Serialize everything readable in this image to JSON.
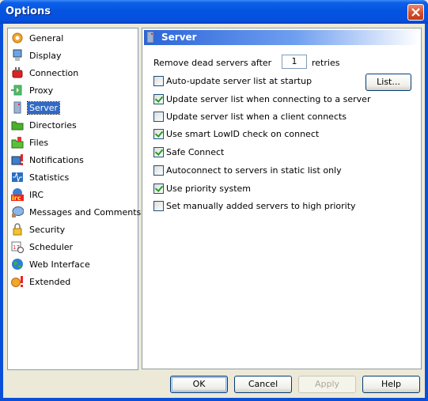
{
  "window": {
    "title": "Options"
  },
  "sidebar": {
    "selected": "Server",
    "items": [
      {
        "label": "General",
        "icon": "gear-icon"
      },
      {
        "label": "Display",
        "icon": "monitor-icon"
      },
      {
        "label": "Connection",
        "icon": "plug-icon"
      },
      {
        "label": "Proxy",
        "icon": "proxy-icon"
      },
      {
        "label": "Server",
        "icon": "server-icon"
      },
      {
        "label": "Directories",
        "icon": "folder-icon"
      },
      {
        "label": "Files",
        "icon": "files-icon"
      },
      {
        "label": "Notifications",
        "icon": "notification-icon"
      },
      {
        "label": "Statistics",
        "icon": "statistics-icon"
      },
      {
        "label": "IRC",
        "icon": "irc-icon"
      },
      {
        "label": "Messages and Comments",
        "icon": "messages-icon"
      },
      {
        "label": "Security",
        "icon": "lock-icon"
      },
      {
        "label": "Scheduler",
        "icon": "calendar-clock-icon"
      },
      {
        "label": "Web Interface",
        "icon": "globe-icon"
      },
      {
        "label": "Extended",
        "icon": "gear-alert-icon"
      }
    ]
  },
  "panel": {
    "title": "Server",
    "remove_dead": {
      "prefix": "Remove dead servers after",
      "value": "1",
      "suffix": "retries"
    },
    "list_button": "List...",
    "options": [
      {
        "label": "Auto-update server list at startup",
        "checked": false
      },
      {
        "label": "Update server list when connecting to a server",
        "checked": true
      },
      {
        "label": "Update server list when a client connects",
        "checked": false
      },
      {
        "label": "Use smart LowID check on connect",
        "checked": true
      },
      {
        "label": "Safe Connect",
        "checked": true
      },
      {
        "label": "Autoconnect to servers in static list only",
        "checked": false
      },
      {
        "label": "Use priority system",
        "checked": true
      },
      {
        "label": "Set manually added servers to high priority",
        "checked": false
      }
    ]
  },
  "buttons": {
    "ok": "OK",
    "cancel": "Cancel",
    "apply": "Apply",
    "help": "Help"
  }
}
